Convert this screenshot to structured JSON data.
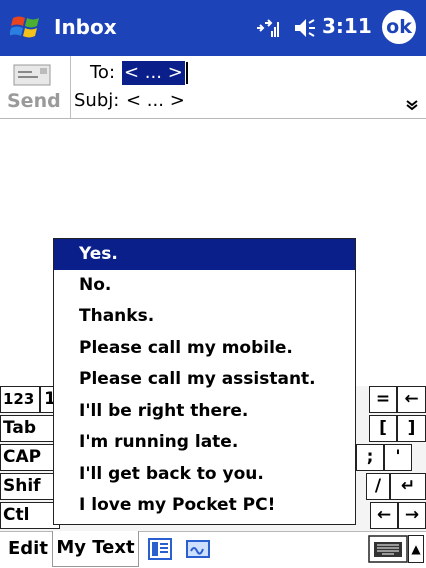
{
  "titlebar": {
    "app_title": "Inbox",
    "time": "3:11",
    "ok_label": "ok",
    "icons": [
      "windows-logo",
      "connectivity-icon",
      "volume-icon"
    ]
  },
  "header": {
    "send_label": "Send",
    "to_label": "To:",
    "to_value": "< ... >",
    "subj_label": "Subj:",
    "subj_value": "< ... >",
    "expand_glyph": "»"
  },
  "my_text_menu": {
    "items": [
      "Yes.",
      "No.",
      "Thanks.",
      "Please call my mobile.",
      "Please call my assistant.",
      "I'll be right there.",
      "I'm running late.",
      "I'll get back to you.",
      "I love my Pocket PC!"
    ],
    "selected_index": 0
  },
  "keyboard": {
    "left_keys": [
      "123",
      "Tab",
      "CAP",
      "Shif",
      "Ctl"
    ],
    "row1_fragment": "1",
    "right_keys": {
      "row1": [
        "=",
        "←"
      ],
      "row2": [
        "[",
        "]"
      ],
      "row3": [
        ";",
        "'"
      ],
      "row4": [
        "/",
        "↵"
      ],
      "row5": [
        "←",
        "→"
      ]
    }
  },
  "bottombar": {
    "edit_label": "Edit",
    "mytext_label": "My Text",
    "icons": [
      "templates-icon",
      "signature-icon",
      "keyboard-icon",
      "input-arrow-icon"
    ],
    "arrow_glyph": "▲"
  },
  "colors": {
    "titlebar": "#1c43b8",
    "selection": "#0a1f8a"
  }
}
